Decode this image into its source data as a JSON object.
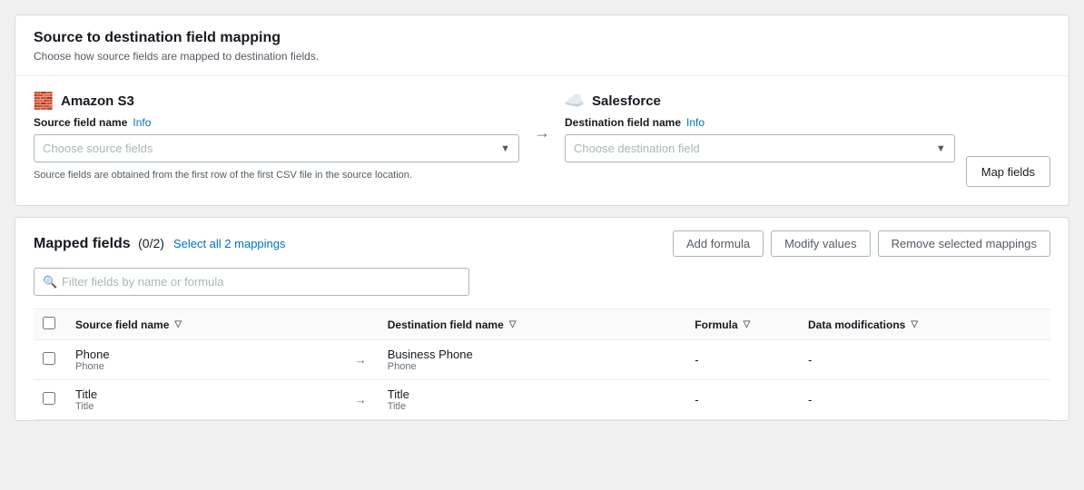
{
  "page": {
    "wrapper_bg": "#f0f0f0"
  },
  "section1": {
    "title": "Source to destination field mapping",
    "subtitle": "Choose how source fields are mapped to destination fields."
  },
  "source": {
    "service_name": "Amazon S3",
    "field_label": "Source field name",
    "info_label": "Info",
    "placeholder": "Choose source fields",
    "helper_text": "Source fields are obtained from the first row of the first CSV file in the source location."
  },
  "destination": {
    "service_name": "Salesforce",
    "field_label": "Destination field name",
    "info_label": "Info",
    "placeholder": "Choose destination field",
    "map_button_label": "Map fields"
  },
  "mapped_fields": {
    "title": "Mapped fields",
    "count": "(0/2)",
    "select_all_label": "Select all 2 mappings",
    "add_formula_label": "Add formula",
    "modify_values_label": "Modify values",
    "remove_label": "Remove selected mappings",
    "search_placeholder": "Filter fields by name or formula"
  },
  "table": {
    "columns": [
      {
        "key": "source",
        "label": "Source field name"
      },
      {
        "key": "dest",
        "label": "Destination field name"
      },
      {
        "key": "formula",
        "label": "Formula"
      },
      {
        "key": "data_mod",
        "label": "Data modifications"
      }
    ],
    "rows": [
      {
        "source_main": "Phone",
        "source_sub": "Phone",
        "dest_main": "Business Phone",
        "dest_sub": "Phone",
        "formula": "-",
        "data_mod": "-"
      },
      {
        "source_main": "Title",
        "source_sub": "Title",
        "dest_main": "Title",
        "dest_sub": "Title",
        "formula": "-",
        "data_mod": "-"
      }
    ]
  }
}
